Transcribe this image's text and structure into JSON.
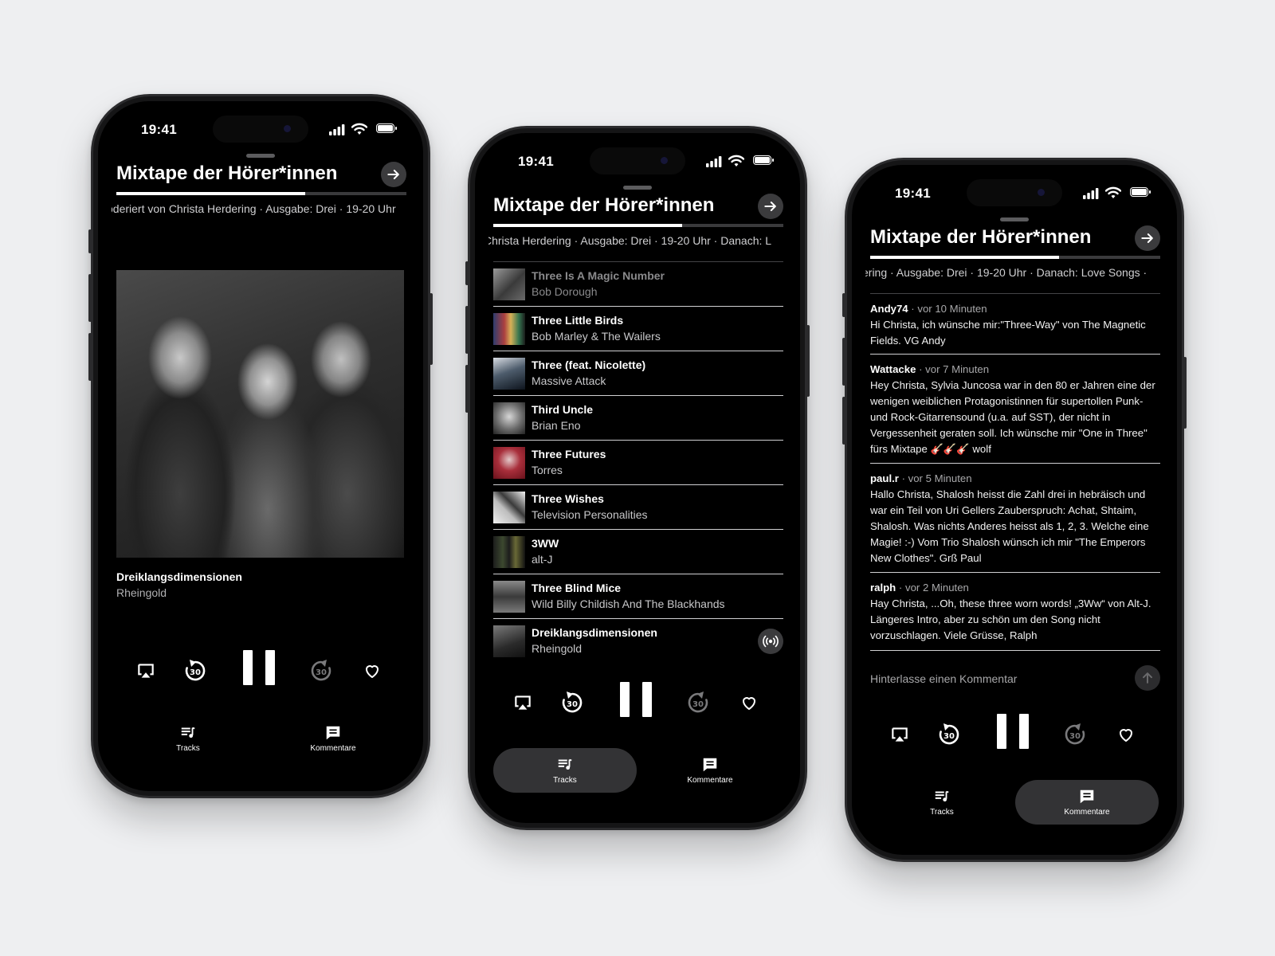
{
  "status": {
    "time": "19:41"
  },
  "header": {
    "title": "Mixtape der Hörer*innen",
    "progress": 0.65,
    "ticker": {
      "p1": "oderiert von Christa Herdering  ·  Ausgabe: Drei  ·  19-20 Uhr",
      "p2": "Christa Herdering  ·  Ausgabe: Drei  ·  19-20 Uhr  ·  Danach: L",
      "p3": "ering  ·  Ausgabe: Drei  ·  19-20 Uhr  ·  Danach: Love Songs  ·"
    }
  },
  "now_playing": {
    "title": "Dreiklangsdimensionen",
    "artist": "Rheingold"
  },
  "tabs": {
    "tracks": "Tracks",
    "comments": "Kommentare"
  },
  "tracks": [
    {
      "title": "Three Is A Magic Number",
      "artist": "Bob Dorough"
    },
    {
      "title": "Three Little Birds",
      "artist": "Bob Marley & The Wailers"
    },
    {
      "title": "Three (feat. Nicolette)",
      "artist": "Massive Attack"
    },
    {
      "title": "Third Uncle",
      "artist": "Brian Eno"
    },
    {
      "title": "Three Futures",
      "artist": "Torres"
    },
    {
      "title": "Three Wishes",
      "artist": "Television Personalities"
    },
    {
      "title": "3WW",
      "artist": "alt-J"
    },
    {
      "title": "Three Blind Mice",
      "artist": "Wild Billy Childish And The Blackhands"
    },
    {
      "title": "Dreiklangsdimensionen",
      "artist": "Rheingold"
    }
  ],
  "comments": [
    {
      "author": "Andy74",
      "when": " · vor 10 Minuten",
      "text": "Hi Christa, ich wünsche mir:\"Three-Way\" von The Magnetic Fields. VG Andy"
    },
    {
      "author": "Wattacke",
      "when": " · vor 7 Minuten",
      "text": "Hey Christa, Sylvia Juncosa war in den 80 er Jahren eine der wenigen weiblichen Protagonistinnen für supertollen Punk- und Rock-Gitarrensound (u.a. auf SST), der nicht in Vergessenheit geraten soll. Ich wünsche mir \"One in Three\" fürs Mixtape 🎸🎸🎸 wolf"
    },
    {
      "author": "paul.r",
      "when": " · vor 5 Minuten",
      "text": "Hallo Christa, Shalosh heisst die Zahl drei in hebräisch und war ein Teil von Uri Gellers Zauberspruch: Achat, Shtaim, Shalosh. Was nichts Anderes heisst als 1, 2, 3. Welche eine Magie! :-) Vom Trio Shalosh wünsch ich mir \"The Emperors New Clothes\". Grß Paul"
    },
    {
      "author": "ralph",
      "when": " · vor 2 Minuten",
      "text": "Hay Christa, ...Oh, these three worn words! „3Ww“ von Alt-J. Längeres Intro, aber zu schön um den Song nicht vorzuschlagen. Viele Grüsse, Ralph"
    }
  ],
  "comment_input": {
    "placeholder": "Hinterlasse einen Kommentar"
  },
  "icons": {
    "airplay": "airplay-icon",
    "rewind": "rewind-30-icon",
    "pause": "pause-icon",
    "forward": "forward-30-icon",
    "like": "heart-icon",
    "tracks": "playlist-icon",
    "comments": "comment-icon",
    "live": "broadcast-icon",
    "send": "send-arrow-up-icon",
    "next": "arrow-right-icon"
  }
}
